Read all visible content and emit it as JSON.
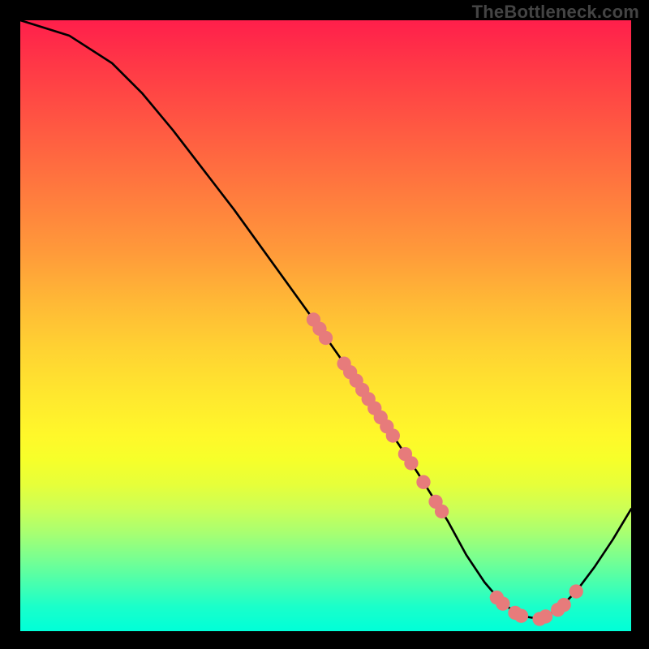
{
  "branding": "TheBottleneck.com",
  "chart_data": {
    "type": "line",
    "title": "",
    "xlabel": "",
    "ylabel": "",
    "x_range": [
      0,
      100
    ],
    "y_range": [
      0,
      100
    ],
    "curve": [
      {
        "x": 0,
        "y": 100
      },
      {
        "x": 8,
        "y": 97.5
      },
      {
        "x": 15,
        "y": 93
      },
      {
        "x": 20,
        "y": 88
      },
      {
        "x": 25,
        "y": 82
      },
      {
        "x": 35,
        "y": 69
      },
      {
        "x": 48,
        "y": 51
      },
      {
        "x": 55,
        "y": 41
      },
      {
        "x": 60,
        "y": 33.5
      },
      {
        "x": 65,
        "y": 26
      },
      {
        "x": 70,
        "y": 18
      },
      {
        "x": 73,
        "y": 12.5
      },
      {
        "x": 76,
        "y": 8
      },
      {
        "x": 79,
        "y": 4.5
      },
      {
        "x": 82,
        "y": 2.5
      },
      {
        "x": 85,
        "y": 2
      },
      {
        "x": 88,
        "y": 3.5
      },
      {
        "x": 91,
        "y": 6.5
      },
      {
        "x": 94,
        "y": 10.5
      },
      {
        "x": 97,
        "y": 15
      },
      {
        "x": 100,
        "y": 20
      }
    ],
    "markers": [
      {
        "x": 48,
        "y": 51
      },
      {
        "x": 49,
        "y": 49.5
      },
      {
        "x": 50,
        "y": 48
      },
      {
        "x": 53,
        "y": 43.8
      },
      {
        "x": 54,
        "y": 42.4
      },
      {
        "x": 55,
        "y": 41
      },
      {
        "x": 56,
        "y": 39.5
      },
      {
        "x": 57,
        "y": 38
      },
      {
        "x": 58,
        "y": 36.5
      },
      {
        "x": 59,
        "y": 35
      },
      {
        "x": 60,
        "y": 33.5
      },
      {
        "x": 61,
        "y": 32
      },
      {
        "x": 63,
        "y": 29
      },
      {
        "x": 64,
        "y": 27.5
      },
      {
        "x": 66,
        "y": 24.4
      },
      {
        "x": 68,
        "y": 21.2
      },
      {
        "x": 69,
        "y": 19.6
      },
      {
        "x": 78,
        "y": 5.5
      },
      {
        "x": 79,
        "y": 4.5
      },
      {
        "x": 81,
        "y": 3
      },
      {
        "x": 82,
        "y": 2.5
      },
      {
        "x": 85,
        "y": 2
      },
      {
        "x": 86,
        "y": 2.4
      },
      {
        "x": 88,
        "y": 3.5
      },
      {
        "x": 89,
        "y": 4.3
      },
      {
        "x": 91,
        "y": 6.5
      }
    ],
    "marker_color": "#e77b7b",
    "line_color": "#000000"
  }
}
